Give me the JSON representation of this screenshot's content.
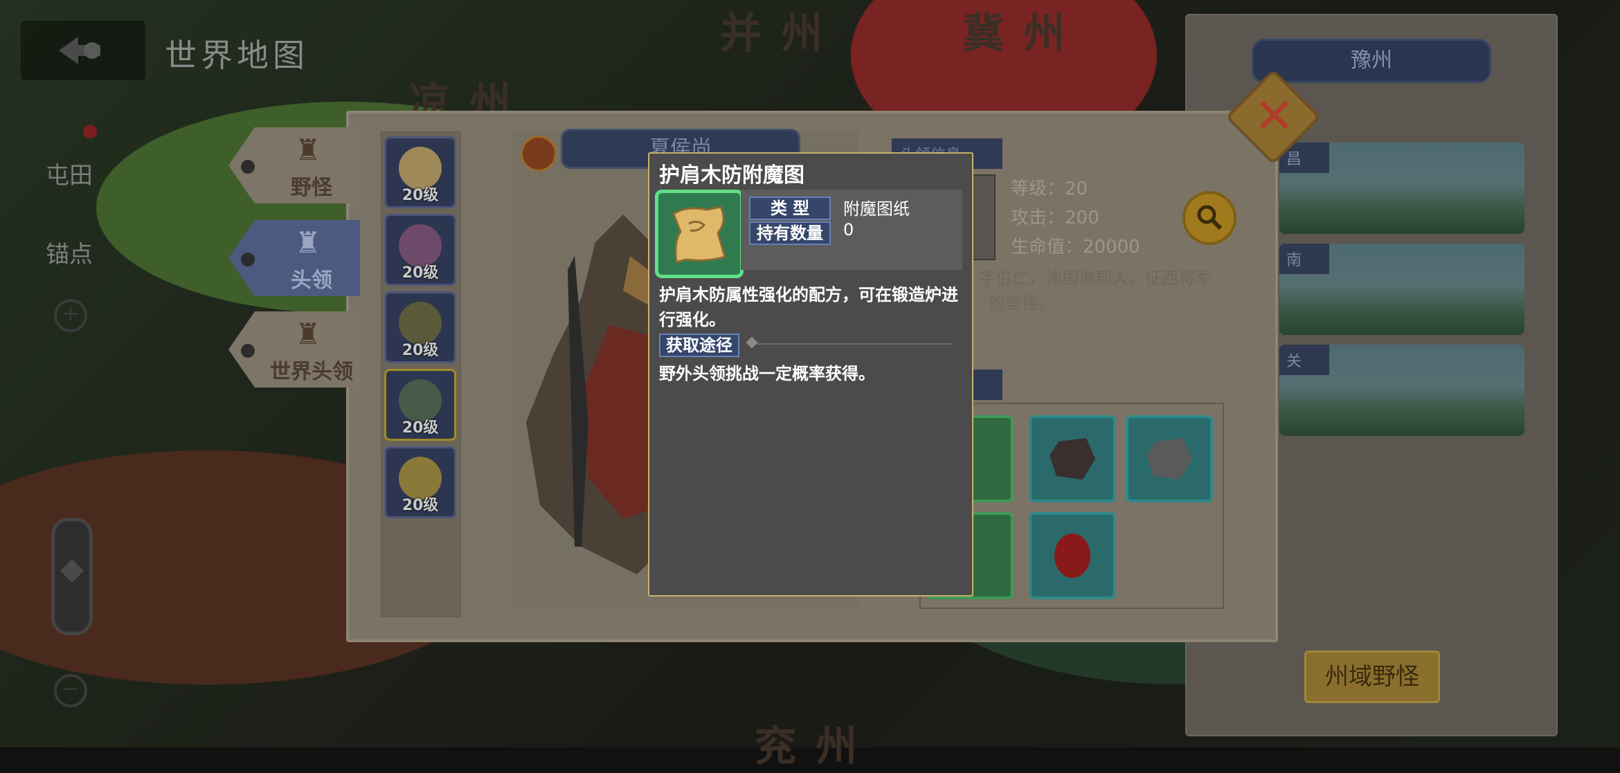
{
  "map": {
    "regions": [
      "并州",
      "冀州",
      "凉州",
      "兖州"
    ]
  },
  "header": {
    "title": "世界地图"
  },
  "left_controls": {
    "farm_label": "屯田",
    "anchor_label": "锚点"
  },
  "province_panel": {
    "title": "豫州",
    "cards": [
      "昌",
      "南",
      "关"
    ],
    "field_monster_button": "州域野怪"
  },
  "dialog": {
    "tabs": [
      {
        "label": "野怪",
        "active": false
      },
      {
        "label": "头领",
        "active": true
      },
      {
        "label": "世界头领",
        "active": false
      }
    ],
    "bosses": [
      {
        "level": "20级",
        "selected": false
      },
      {
        "level": "20级",
        "selected": false
      },
      {
        "level": "20级",
        "selected": false
      },
      {
        "level": "20级",
        "selected": true
      },
      {
        "level": "20级",
        "selected": false
      }
    ],
    "boss_name": "夏侯尚",
    "info_label": "头领信息",
    "stats": {
      "level": "等级：20",
      "attack": "攻击：200",
      "hp": "生命值：20000"
    },
    "description_line1": "字伯仁，沛国谯郡人，征西将军",
    "description_line2": "的堂侄。",
    "drops_label": "头领掉落"
  },
  "tooltip": {
    "title": "护肩木防附魔图",
    "type_label": "类 型",
    "type_value": "附魔图纸",
    "count_label": "持有数量",
    "count_value": "0",
    "description": "护肩木防属性强化的配方，可在锻造炉进行强化。",
    "source_label": "获取途径",
    "source_text": "野外头领挑战一定概率获得。"
  },
  "colors": {
    "tooltip_border": "#c9b16d",
    "item_frame": "#5fe088",
    "label_bg": "#35466a"
  }
}
